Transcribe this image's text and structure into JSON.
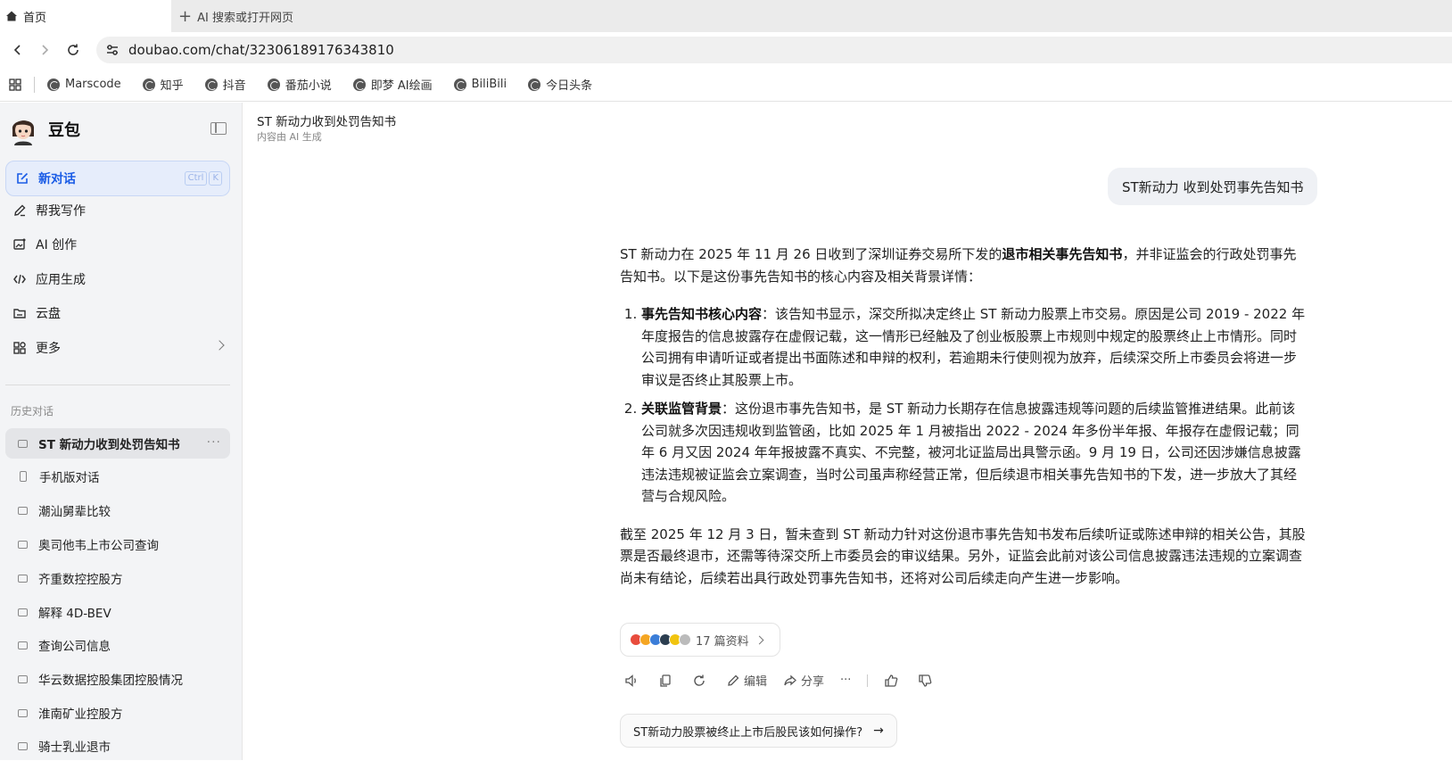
{
  "browser": {
    "active_tab": "首页",
    "new_tab_label": "AI 搜索或打开网页",
    "url": "doubao.com/chat/32306189176343810",
    "bookmarks": [
      "Marscode",
      "知乎",
      "抖音",
      "番茄小说",
      "即梦 AI绘画",
      "BiliBili",
      "今日头条"
    ]
  },
  "sidebar": {
    "brand": "豆包",
    "new_chat": "新对话",
    "shortcut": [
      "Ctrl",
      "K"
    ],
    "menu": [
      {
        "label": "帮我写作",
        "icon": "pen-icon"
      },
      {
        "label": "AI 创作",
        "icon": "image-create-icon"
      },
      {
        "label": "应用生成",
        "icon": "code-icon"
      },
      {
        "label": "云盘",
        "icon": "cloud-drive-icon"
      },
      {
        "label": "更多",
        "icon": "grid-icon"
      }
    ],
    "history_title": "历史对话",
    "history": [
      {
        "label": "ST 新动力收到处罚告知书",
        "active": true
      },
      {
        "label": "手机版对话",
        "active": false
      },
      {
        "label": "潮汕舅辈比较",
        "active": false
      },
      {
        "label": "奥司他韦上市公司查询",
        "active": false
      },
      {
        "label": "齐重数控控股方",
        "active": false
      },
      {
        "label": "解释 4D-BEV",
        "active": false
      },
      {
        "label": "查询公司信息",
        "active": false
      },
      {
        "label": "华云数据控股集团控股情况",
        "active": false
      },
      {
        "label": "淮南矿业控股方",
        "active": false
      },
      {
        "label": "骑士乳业退市",
        "active": false
      }
    ]
  },
  "main": {
    "title": "ST 新动力收到处罚告知书",
    "subtitle": "内容由 AI 生成",
    "user_message": "ST新动力 收到处罚事先告知书",
    "answer": {
      "intro_pre": "ST 新动力在 2025 年 11 月 26 日收到了深圳证券交易所下发的",
      "intro_bold": "退市相关事先告知书",
      "intro_post": "，并非证监会的行政处罚事先告知书。以下是这份事先告知书的核心内容及相关背景详情：",
      "item1_bold": "事先告知书核心内容",
      "item1_text": "：该告知书显示，深交所拟决定终止 ST 新动力股票上市交易。原因是公司 2019 - 2022 年年度报告的信息披露存在虚假记载，这一情形已经触及了创业板股票上市规则中规定的股票终止上市情形。同时公司拥有申请听证或者提出书面陈述和申辩的权利，若逾期未行使则视为放弃，后续深交所上市委员会将进一步审议是否终止其股票上市。",
      "item2_bold": "关联监管背景",
      "item2_text": "：这份退市事先告知书，是 ST 新动力长期存在信息披露违规等问题的后续监管推进结果。此前该公司就多次因违规收到监管函，比如 2025 年 1 月被指出 2022 - 2024 年多份半年报、年报存在虚假记载；同年 6 月又因 2024 年年报披露不真实、不完整，被河北证监局出具警示函。9 月 19 日，公司还因涉嫌信息披露违法违规被证监会立案调查，当时公司虽声称经营正常，但后续退市相关事先告知书的下发，进一步放大了其经营与合规风险。",
      "conclusion": "截至 2025 年 12 月 3 日，暂未查到 ST 新动力针对这份退市事先告知书发布后续听证或陈述申辩的相关公告，其股票是否最终退市，还需等待深交所上市委员会的审议结果。另外，证监会此前对该公司信息披露违法违规的立案调查尚未有结论，后续若出具行政处罚事先告知书，还将对公司后续走向产生进一步影响。"
    },
    "refs_label": "17 篇资料",
    "actions": {
      "edit": "编辑",
      "share": "分享"
    },
    "suggestion": "ST新动力股票被终止上市后股民该如何操作?",
    "colors": {
      "accent": "#1a5ce6",
      "bubble": "#eff1f5",
      "sidebar": "#f3f4f6"
    }
  }
}
